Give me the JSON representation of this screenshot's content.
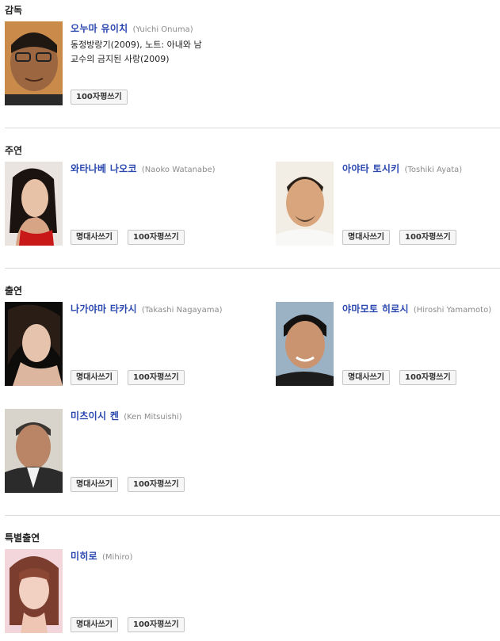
{
  "sections": {
    "director": {
      "title": "감독"
    },
    "lead": {
      "title": "주연"
    },
    "support": {
      "title": "출연"
    },
    "special": {
      "title": "특별출연"
    }
  },
  "buttons": {
    "quote": "명대사쓰기",
    "review": "100자평쓰기"
  },
  "people": {
    "onuma": {
      "name": "오누마 유이치",
      "eng": "(Yuichi Onuma)",
      "works": "동정방랑기(2009), 노트: 아내와 남교수의 금지된 사랑(2009)"
    },
    "watanabe": {
      "name": "와타나베 나오코",
      "eng": "(Naoko Watanabe)"
    },
    "ayata": {
      "name": "아야타 토시키",
      "eng": "(Toshiki Ayata)"
    },
    "nagayama": {
      "name": "나가야마 타카시",
      "eng": "(Takashi Nagayama)"
    },
    "yamamoto": {
      "name": "야마모토 히로시",
      "eng": "(Hiroshi Yamamoto)"
    },
    "mitsuishi": {
      "name": "미츠이시 켄",
      "eng": "(Ken Mitsuishi)"
    },
    "mihiro": {
      "name": "미히로",
      "eng": "(Mihiro)"
    }
  }
}
